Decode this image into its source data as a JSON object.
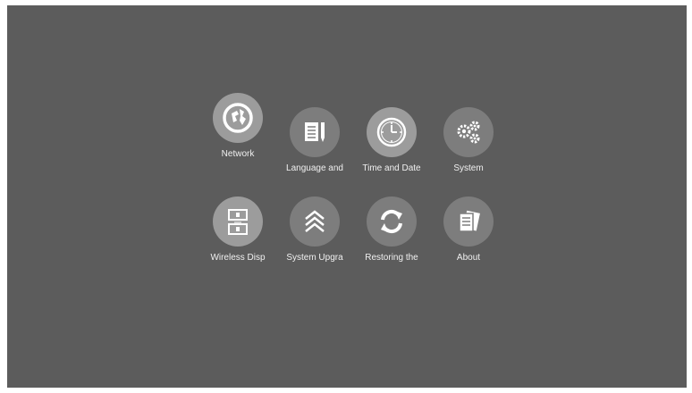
{
  "menu": {
    "items": [
      {
        "label": "Network",
        "icon": "network-icon"
      },
      {
        "label": "Language and",
        "icon": "language-icon"
      },
      {
        "label": "Time and Date",
        "icon": "clock-icon"
      },
      {
        "label": "System",
        "icon": "gears-icon"
      },
      {
        "label": "Wireless Disp",
        "icon": "wireless-display-icon"
      },
      {
        "label": "System Upgra",
        "icon": "upgrade-chevrons-icon"
      },
      {
        "label": "Restoring the",
        "icon": "restore-icon"
      },
      {
        "label": "About",
        "icon": "about-document-icon"
      }
    ]
  },
  "colors": {
    "screen_background": "#5c5c5c",
    "icon_circle": "#7d7d7d",
    "icon_circle_highlight": "#9c9c9c",
    "label_text": "#f0f0f0"
  }
}
